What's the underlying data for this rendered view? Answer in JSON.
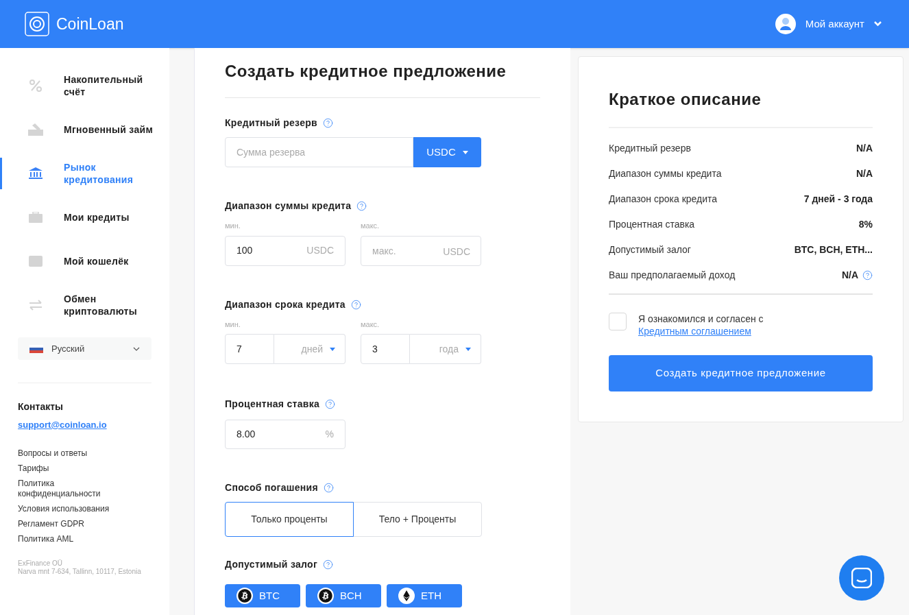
{
  "header": {
    "logo": "CoinLoan",
    "account": "Мой аккаунт"
  },
  "sidebar": {
    "items": [
      {
        "label": "Накопительный счёт",
        "kind": "percent",
        "selected": false
      },
      {
        "label": "Мгновенный займ",
        "kind": "check",
        "selected": false
      },
      {
        "label": "Рынок кредитования",
        "kind": "bank",
        "selected": true
      },
      {
        "label": "Мои кредиты",
        "kind": "briefcase",
        "selected": false
      },
      {
        "label": "Мой кошелёк",
        "kind": "wallet",
        "selected": false
      },
      {
        "label": "Обмен криптовалюты",
        "kind": "exchange",
        "selected": false
      }
    ],
    "language": "Русский",
    "contacts_title": "Контакты",
    "email": "support@coinloan.io",
    "links": [
      "Вопросы и ответы",
      "Тарифы",
      "Политика конфиденциальности",
      "Условия использования",
      "Регламент GDPR",
      "Политика AML"
    ],
    "company": "ExFinance OÜ",
    "address": "Narva mnt 7-634, Tallinn, 10117, Estonia"
  },
  "form": {
    "title": "Создать кредитное предложение",
    "reserve": {
      "label": "Кредитный резерв",
      "placeholder": "Сумма резерва",
      "currency": "USDC"
    },
    "amount_range": {
      "label": "Диапазон суммы кредита",
      "min_label": "мин.",
      "min_value": "100",
      "min_unit": "USDC",
      "max_label": "макс.",
      "max_placeholder": "макс.",
      "max_unit": "USDC"
    },
    "term_range": {
      "label": "Диапазон срока кредита",
      "min_label": "мин.",
      "min_value": "7",
      "min_unit": "дней",
      "max_label": "макс.",
      "max_value": "3",
      "max_unit": "года"
    },
    "rate": {
      "label": "Процентная ставка",
      "value": "8.00",
      "unit": "%"
    },
    "repayment": {
      "label": "Способ погашения",
      "options": [
        {
          "label": "Только проценты",
          "selected": true
        },
        {
          "label": "Тело + Проценты",
          "selected": false
        }
      ]
    },
    "collateral": {
      "label": "Допустимый залог",
      "coins": [
        {
          "label": "BTC",
          "kind": "bitcoin"
        },
        {
          "label": "BCH",
          "kind": "bitcoin"
        },
        {
          "label": "ETH",
          "kind": "ether"
        }
      ]
    }
  },
  "summary": {
    "title": "Краткое описание",
    "rows": [
      {
        "label": "Кредитный резерв",
        "value": "N/A",
        "help": false
      },
      {
        "label": "Диапазон суммы кредита",
        "value": "N/A",
        "help": false
      },
      {
        "label": "Диапазон срока кредита",
        "value": "7 дней - 3 года",
        "help": false
      },
      {
        "label": "Процентная ставка",
        "value": "8%",
        "help": false
      },
      {
        "label": "Допустимый залог",
        "value": "BTC, BCH, ETH...",
        "help": false
      },
      {
        "label": "Ваш предполагаемый доход",
        "value": "N/A",
        "help": true
      }
    ],
    "agree_text": "Я ознакомился и согласен с",
    "agree_link": "Кредитным соглашением",
    "checked": false,
    "button": "Создать кредитное предложение"
  }
}
